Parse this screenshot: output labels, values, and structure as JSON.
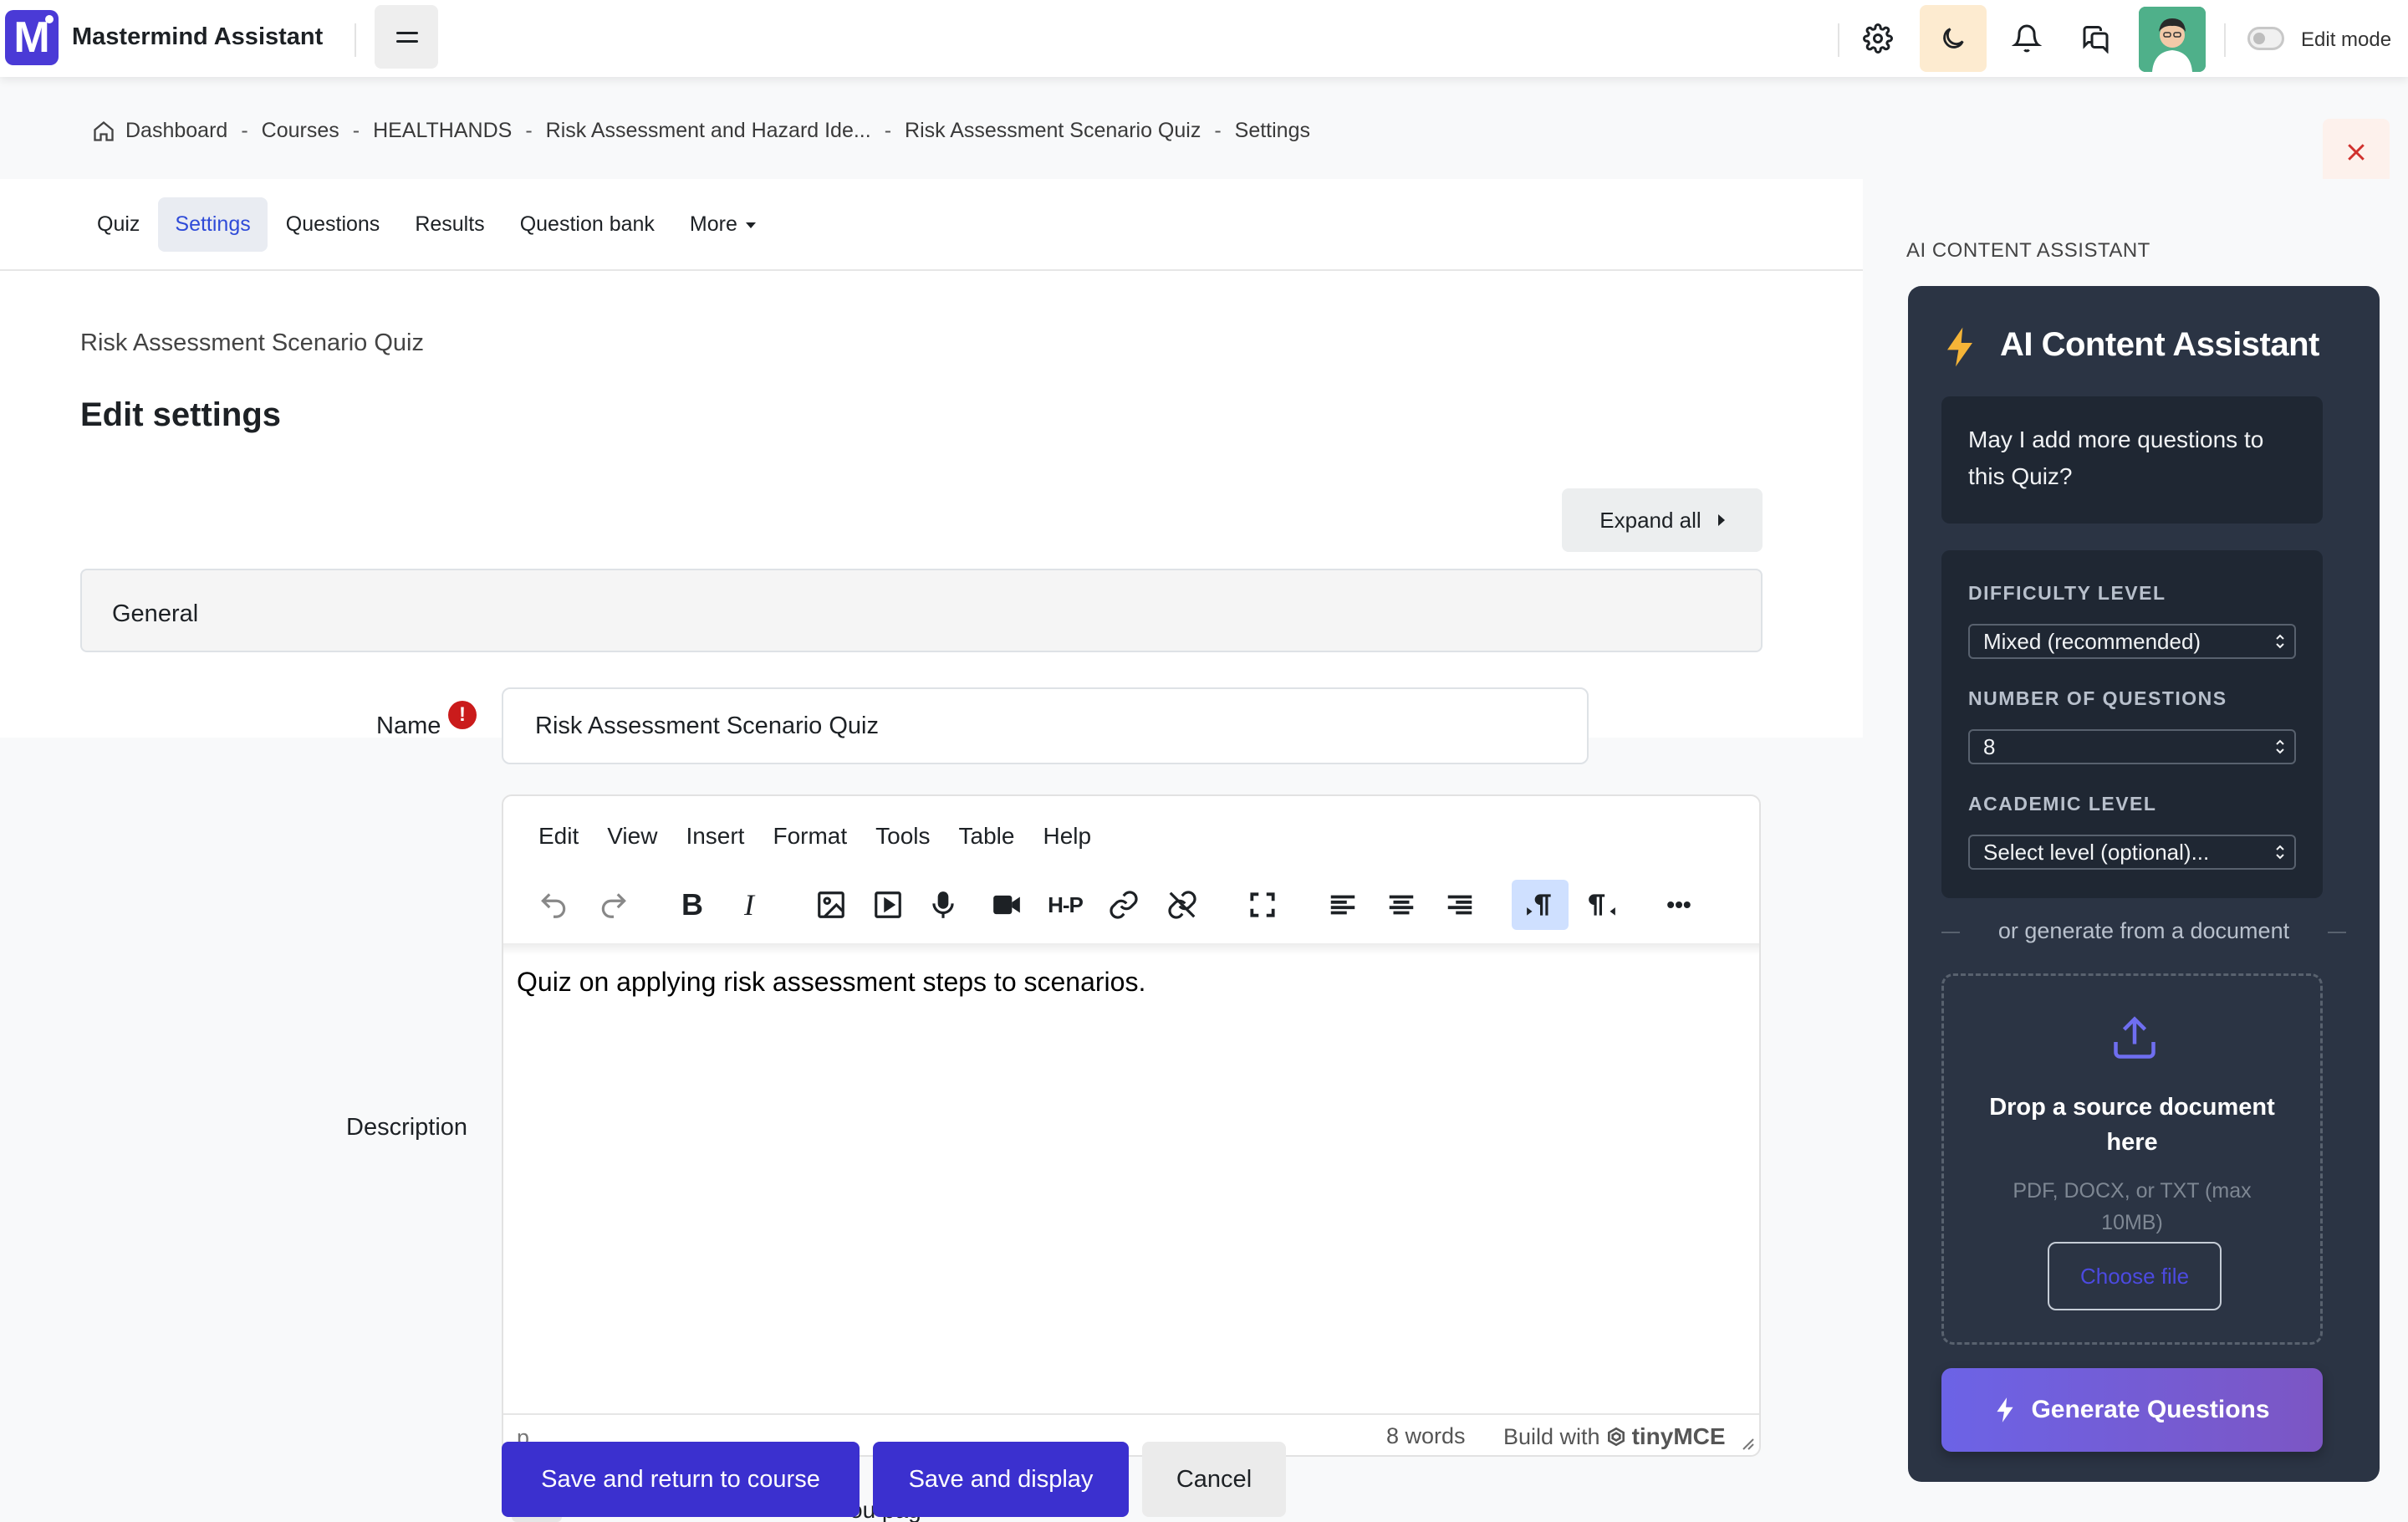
{
  "app": {
    "logo_letter": "M",
    "title": "Mastermind Assistant",
    "edit_mode_label": "Edit mode",
    "edit_mode_on": false
  },
  "colors": {
    "brand": "#4a3ad6",
    "primary_button": "#3b30cf",
    "ai_panel": "#2b3444",
    "ai_inner": "#1f2733",
    "active_tab_text": "#2f4bd8",
    "required": "#ca1b1b"
  },
  "breadcrumb": [
    "Dashboard",
    "Courses",
    "HEALTHANDS",
    "Risk Assessment and Hazard Ide...",
    "Risk Assessment Scenario Quiz",
    "Settings"
  ],
  "breadcrumb_separator": "-",
  "tabs": [
    {
      "label": "Quiz",
      "active": false
    },
    {
      "label": "Settings",
      "active": true
    },
    {
      "label": "Questions",
      "active": false
    },
    {
      "label": "Results",
      "active": false
    },
    {
      "label": "Question bank",
      "active": false
    },
    {
      "label": "More",
      "active": false
    }
  ],
  "page": {
    "course_name": "Risk Assessment Scenario Quiz",
    "title": "Edit settings",
    "expand_all": "Expand all",
    "section_general": "General",
    "required_mark": "!"
  },
  "form": {
    "name_label": "Name",
    "name_value": "Risk Assessment Scenario Quiz",
    "description_label": "Description"
  },
  "editor": {
    "menu": [
      "Edit",
      "View",
      "Insert",
      "Format",
      "Tools",
      "Table",
      "Help"
    ],
    "content": "Quiz on applying risk assessment steps to scenarios.",
    "path": "p",
    "word_count": "8 words",
    "build_with": "Build with",
    "brand": "tinyMCE",
    "toolbar": [
      "undo-icon",
      "redo-icon",
      "bold-icon",
      "italic-icon",
      "image-icon",
      "media-icon",
      "microphone-icon",
      "video-icon",
      "h5p-icon",
      "link-icon",
      "unlink-icon",
      "fullscreen-icon",
      "align-left-icon",
      "align-center-icon",
      "align-right-icon",
      "ltr-icon",
      "rtl-icon",
      "more-icon"
    ],
    "toolbar_active": "ltr-icon",
    "h5p_text": "H-P",
    "bold_text": "B",
    "italic_text": "I",
    "more_text": "•••"
  },
  "actions": {
    "save_return": "Save and return to course",
    "save_display": "Save and display",
    "cancel": "Cancel",
    "obscured_text": "ou  pag"
  },
  "ai": {
    "section_heading": "AI CONTENT ASSISTANT",
    "title": "AI Content Assistant",
    "question": "May I add more questions to this Quiz?",
    "difficulty_label": "DIFFICULTY LEVEL",
    "difficulty_value": "Mixed (recommended)",
    "count_label": "NUMBER OF QUESTIONS",
    "count_value": "8",
    "academic_label": "ACADEMIC LEVEL",
    "academic_placeholder": "Select level (optional)...",
    "or_text": "or generate from a document",
    "drop_title": "Drop a source document here",
    "drop_sub": "PDF, DOCX, or TXT (max 10MB)",
    "choose_file": "Choose file",
    "generate": "Generate Questions"
  }
}
